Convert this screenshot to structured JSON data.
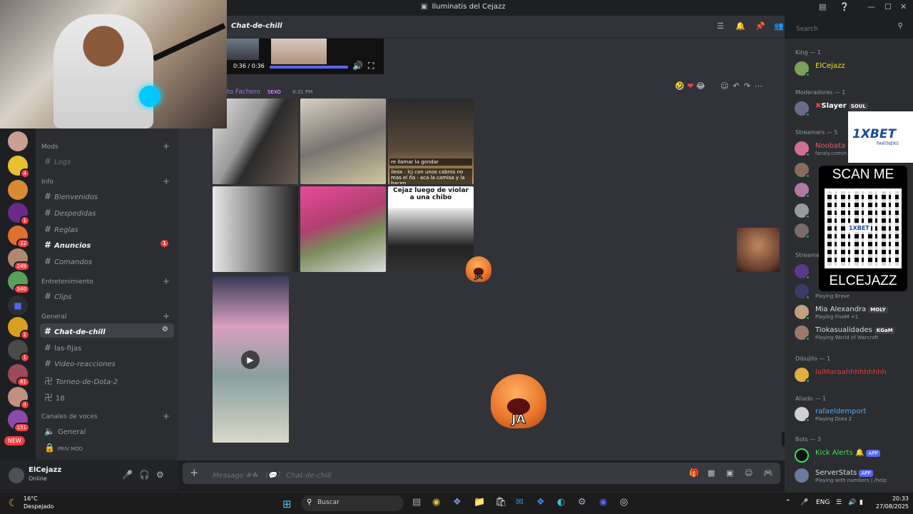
{
  "window": {
    "title": "Iluminatis del Cejazz"
  },
  "header": {
    "channel_name": "Chat-de-chill",
    "search_placeholder": "Search"
  },
  "server_rail": {
    "badges": [
      "4",
      "1",
      "22",
      "249",
      "340",
      "1",
      "1",
      "61",
      "4",
      "151"
    ],
    "new_label": "NEW"
  },
  "channels": {
    "categories": {
      "mods": "Mods",
      "info": "Info",
      "entretenimiento": "Entretenimiento",
      "general": "General",
      "voz": "Canales de voces"
    },
    "logs": "Logs",
    "bienvenidos": "Bienvenidos",
    "despedidas": "Despedidas",
    "reglas": "Reglas",
    "anuncios": "Anuncios",
    "anuncios_badge": "1",
    "comandos": "Comandos",
    "clips": "Clips",
    "chat_de_chill": "Chat-de-chill",
    "las_fijas": "las-fijas",
    "video_reacciones": "Video-reacciones",
    "torneo": "Torneo-de-Dota-2",
    "ch18": "18",
    "voice_general": "General",
    "voice_priv": "PRIV MOD"
  },
  "user_panel": {
    "name": "ElCejazz",
    "status": "Online"
  },
  "video_player": {
    "time": "0:36 / 0:36",
    "progress": 1.0
  },
  "message": {
    "author": "to Fachero",
    "tag": "SEXO",
    "time": "8:31 PM",
    "caption_1": "re llamar la gondar",
    "caption_2": "ileox : lcj con unos cabros no mas el ña · aca la camisa y la hacen",
    "caption_3": "Cejaz luego de violar a una chibo",
    "emote_text": "JA"
  },
  "composer": {
    "placeholder": "Message #☘ 〔💬〕 Chat-de-chill"
  },
  "members": {
    "king_header": "King — 1",
    "king": "ElCejazz",
    "mods_header": "Moderadores — 1",
    "mod": "Slayer",
    "mod_tag": "SOUL",
    "streamers_header": "Streamers — 5",
    "streamer1": "Noobata",
    "streamer1_sub": "fansly.com/n",
    "streamers_header_2": "Streame",
    "playing_brave": "Playing Brave",
    "mia": "Mia Alexandra",
    "mia_tag": "MOLY",
    "mia_sub": "Playing FiveM +1",
    "tiok": "Tiokasualidades",
    "tiok_tag": "KGaM",
    "tiok_sub": "Playing World of Warcraft",
    "dibujito_header": "Dibujito — 1",
    "dibujito": "lalMaraahhhhhhhhh",
    "aliado_header": "Aliado — 1",
    "aliado": "rafaeldemport",
    "aliado_sub": "Playing Dota 2",
    "bots_header": "Bots — 3",
    "bot1": "Kick Alerts",
    "bot2": "ServerStats",
    "bot2_sub": "Playing with numbers | /help",
    "app_label": "APP"
  },
  "ad": {
    "brand": "1XBET",
    "partners": "PARTNERS",
    "scan": "SCAN ME",
    "qr_logo": "1XBET",
    "handle": "ELCEJAZZ"
  },
  "taskbar": {
    "temp": "16°C",
    "condition": "Despejado",
    "search": "Buscar",
    "lang": "ENG",
    "time": "20:33",
    "date": "27/08/2025"
  },
  "colors": {
    "accent": "#5865f2",
    "online": "#23a55a",
    "mention": "#f23f43",
    "king_name": "#f0e030",
    "bot_name": "#3ae05a",
    "aliado_name": "#58a6e8",
    "dibujito_name": "#e03a3a"
  }
}
